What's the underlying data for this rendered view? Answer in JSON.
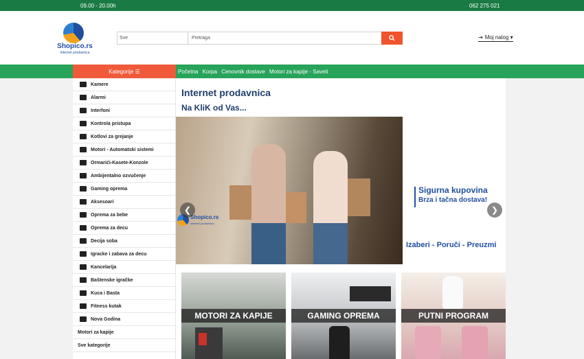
{
  "topbar": {
    "hours": "09.00 - 20.00h",
    "phone": "062 275 021"
  },
  "logo": {
    "brand": "Shopico.rs",
    "tagline": "Internet prodavnica"
  },
  "search": {
    "category": "Sve",
    "placeholder": "Pretraga"
  },
  "account": {
    "label": "Moj nalog ▾"
  },
  "nav": {
    "categories_button": "Kategorije ☰",
    "links": [
      "Početna",
      "Korpa",
      "Cenovnik dostave",
      "Motori za kapije - Saveti"
    ]
  },
  "sidebar": {
    "items": [
      {
        "label": "Kamere",
        "icon": "camera-icon"
      },
      {
        "label": "Alarmi",
        "icon": "alarm-icon"
      },
      {
        "label": "Interfoni",
        "icon": "intercom-icon"
      },
      {
        "label": "Kontrola pristupa",
        "icon": "access-control-icon"
      },
      {
        "label": "Kotlovi za grejanje",
        "icon": "boiler-icon"
      },
      {
        "label": "Motori - Automatski sistemi",
        "icon": "gate-motor-icon"
      },
      {
        "label": "Ormarići-Kasete-Konzole",
        "icon": "cabinet-icon"
      },
      {
        "label": "Ambijentalno ozvučenje",
        "icon": "speaker-icon"
      },
      {
        "label": "Gaming oprema",
        "icon": "gaming-icon"
      },
      {
        "label": "Aksesoari",
        "icon": "briefcase-icon"
      },
      {
        "label": "Oprema za bebe",
        "icon": "baby-icon"
      },
      {
        "label": "Oprema za decu",
        "icon": "stroller-icon"
      },
      {
        "label": "Decija soba",
        "icon": "crib-icon"
      },
      {
        "label": "Igracke i zabava za decu",
        "icon": "toy-icon"
      },
      {
        "label": "Kancelarija",
        "icon": "office-icon"
      },
      {
        "label": "Baštenske igračke",
        "icon": "garden-toy-icon"
      },
      {
        "label": "Kuca i Basta",
        "icon": "house-icon"
      },
      {
        "label": "Fitness kutak",
        "icon": "fitness-icon"
      },
      {
        "label": "Nova Godina",
        "icon": "tree-icon"
      }
    ],
    "plain_items": [
      "Motori za kapije",
      "Sve kategorije"
    ]
  },
  "main": {
    "title": "Internet prodavnica",
    "subtitle": "Na KliK od Vas...",
    "slider": {
      "logo_brand": "Shopico.rs",
      "logo_tagline": "Internet prodavnica",
      "line1": "Sigurna kupovina",
      "line2": "Brza i tačna dostava!",
      "line3": "Izaberi - Poruči - Preuzmi"
    },
    "tiles": [
      "MOTORI ZA KAPIJE",
      "GAMING OPREMA",
      "PUTNI PROGRAM"
    ]
  },
  "colors": {
    "topbar": "#1a7a43",
    "navbar": "#27a35a",
    "accent": "#f05a3a",
    "brand_blue": "#1f4fa0"
  }
}
